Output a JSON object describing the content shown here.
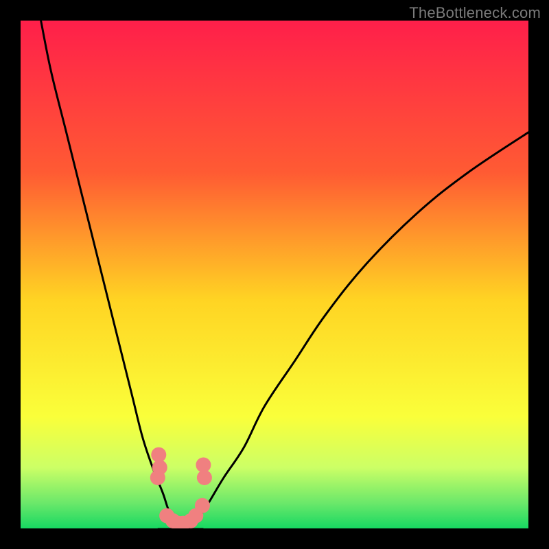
{
  "watermark": "TheBottleneck.com",
  "chart_data": {
    "type": "line",
    "title": "",
    "xlabel": "",
    "ylabel": "",
    "xlim": [
      0,
      100
    ],
    "ylim": [
      0,
      100
    ],
    "gradient_stops": [
      {
        "offset": 0,
        "color": "#ff1f4a"
      },
      {
        "offset": 0.3,
        "color": "#ff5b33"
      },
      {
        "offset": 0.55,
        "color": "#ffd423"
      },
      {
        "offset": 0.78,
        "color": "#faff3a"
      },
      {
        "offset": 0.88,
        "color": "#ccff66"
      },
      {
        "offset": 0.95,
        "color": "#6be86a"
      },
      {
        "offset": 1.0,
        "color": "#17d862"
      }
    ],
    "series": [
      {
        "name": "left-curve",
        "x": [
          4,
          6,
          9,
          12,
          15,
          18,
          20,
          22,
          24,
          26,
          28,
          29,
          30,
          31
        ],
        "values": [
          100,
          90,
          78,
          66,
          54,
          42,
          34,
          26,
          18,
          12,
          7,
          4,
          2,
          0
        ]
      },
      {
        "name": "right-curve",
        "x": [
          33,
          35,
          37,
          40,
          44,
          48,
          54,
          60,
          68,
          78,
          88,
          100
        ],
        "values": [
          0,
          2,
          5,
          10,
          16,
          24,
          33,
          42,
          52,
          62,
          70,
          78
        ]
      }
    ],
    "valley_band": {
      "x_start": 27,
      "x_end": 36,
      "y": 0
    },
    "scatter": [
      {
        "x": 27.2,
        "y": 14.5
      },
      {
        "x": 27.4,
        "y": 12.0
      },
      {
        "x": 27.0,
        "y": 10.0
      },
      {
        "x": 28.8,
        "y": 2.5
      },
      {
        "x": 30.0,
        "y": 1.5
      },
      {
        "x": 31.0,
        "y": 1.0
      },
      {
        "x": 32.0,
        "y": 1.0
      },
      {
        "x": 33.5,
        "y": 1.5
      },
      {
        "x": 34.5,
        "y": 2.5
      },
      {
        "x": 35.8,
        "y": 4.5
      },
      {
        "x": 36.2,
        "y": 10.0
      },
      {
        "x": 36.0,
        "y": 12.5
      }
    ],
    "colors": {
      "curve": "#000000",
      "scatter": "#f08080",
      "frame": "#000000"
    }
  }
}
